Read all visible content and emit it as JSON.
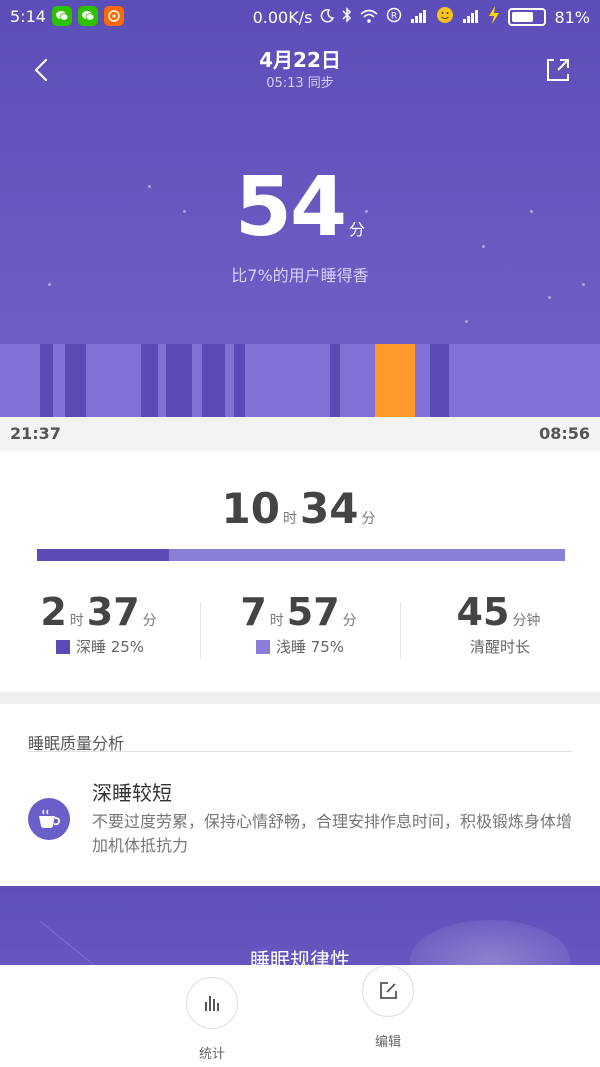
{
  "status_bar": {
    "time": "5:14",
    "network_speed": "0.00K/s",
    "battery_percent": "81%",
    "battery_level": 0.81,
    "icons": [
      "wechat-icon",
      "wechat-icon",
      "orange-app-icon",
      "moon-icon",
      "bluetooth-icon",
      "wifi-icon",
      "r-icon",
      "signal-icon",
      "emoji-icon",
      "signal-icon",
      "charging-icon",
      "battery-icon"
    ]
  },
  "header": {
    "title": "4月22日",
    "sync_text": "05:13 同步",
    "back_icon": "chevron-left-icon",
    "share_icon": "share-icon"
  },
  "score": {
    "value": "54",
    "unit": "分",
    "comparison": "比7%的用户睡得香"
  },
  "timeline": {
    "start": "21:37",
    "end": "08:56",
    "colors": {
      "light": "#7f72d4",
      "deep": "#5a4bb5",
      "awake": "#ff9a2a"
    }
  },
  "duration": {
    "hours": "10",
    "hours_unit": "时",
    "minutes": "34",
    "minutes_unit": "分",
    "deep_fraction": 0.25
  },
  "stats": {
    "deep": {
      "hours": "2",
      "hours_unit": "时",
      "minutes": "37",
      "minutes_unit": "分",
      "label": "深睡 25%",
      "color": "#5b4bb7"
    },
    "light": {
      "hours": "7",
      "hours_unit": "时",
      "minutes": "57",
      "minutes_unit": "分",
      "label": "浅睡 75%",
      "color": "#8a7fd8"
    },
    "awake": {
      "value": "45",
      "unit": "分钟",
      "label": "清醒时长"
    }
  },
  "analysis": {
    "section_title": "睡眠质量分析",
    "item_title": "深睡较短",
    "item_text": "不要过度劳累，保持心情舒畅，合理安排作息时间，积极锻炼身体增加机体抵抗力",
    "icon": "coffee-cup-icon"
  },
  "regularity": {
    "title": "睡眠规律性"
  },
  "tabs": [
    {
      "label": "统计",
      "icon": "bar-chart-icon"
    },
    {
      "label": "编辑",
      "icon": "edit-icon"
    }
  ]
}
